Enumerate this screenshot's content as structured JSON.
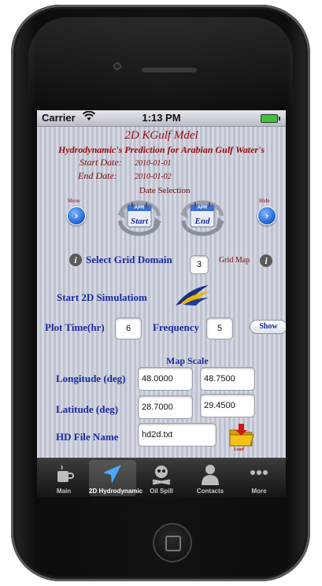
{
  "status_bar": {
    "carrier": "Carrier",
    "time": "1:13 PM"
  },
  "app": {
    "title": "2D KGulf Mdel",
    "subtitle": "Hydrodynamic's Prediction for Arabian Gulf Water's",
    "start_date_label": "Start Date:",
    "start_date_value": "2010-01-01",
    "end_date_label": "End Date:",
    "end_date_value": "2010-01-02",
    "date_selection_label": "Date Selection",
    "show_small_label": "Show",
    "hide_small_label": "Hide",
    "start_button_label": "Start",
    "end_button_label": "End",
    "calendar_month": "APR"
  },
  "grid": {
    "label": "Select Grid Domain",
    "value": "3",
    "map_label": "Grid Map"
  },
  "simulation": {
    "label": "Start 2D Simulatiom"
  },
  "plot": {
    "time_label": "Plot Time(hr)",
    "time_value": "6",
    "frequency_label": "Frequency",
    "frequency_value": "5",
    "show_button": "Show"
  },
  "map_scale": {
    "title": "Map Scale",
    "longitude_label": "Longitude (deg)",
    "longitude_min": "48.0000",
    "longitude_max": "48.7500",
    "latitude_label": "Latitude  (deg)",
    "latitude_min": "28.7000",
    "latitude_max": "29.4500"
  },
  "hd_file": {
    "label": "HD File Name",
    "value": "hd2d.txt",
    "load_label": "Load"
  },
  "tabs": [
    {
      "label": "Main",
      "icon": "coffee-cup-icon"
    },
    {
      "label": "2D Hydrodynamic",
      "icon": "navigation-arrow-icon",
      "active": true
    },
    {
      "label": "Oil Spill",
      "icon": "skull-crossbones-icon"
    },
    {
      "label": "Contacts",
      "icon": "person-icon"
    },
    {
      "label": "More",
      "icon": "more-dots-icon"
    }
  ],
  "colors": {
    "title_red": "#9a0a0a",
    "label_blue": "#1a2ba0",
    "tabbar": "#1e1e1e"
  }
}
